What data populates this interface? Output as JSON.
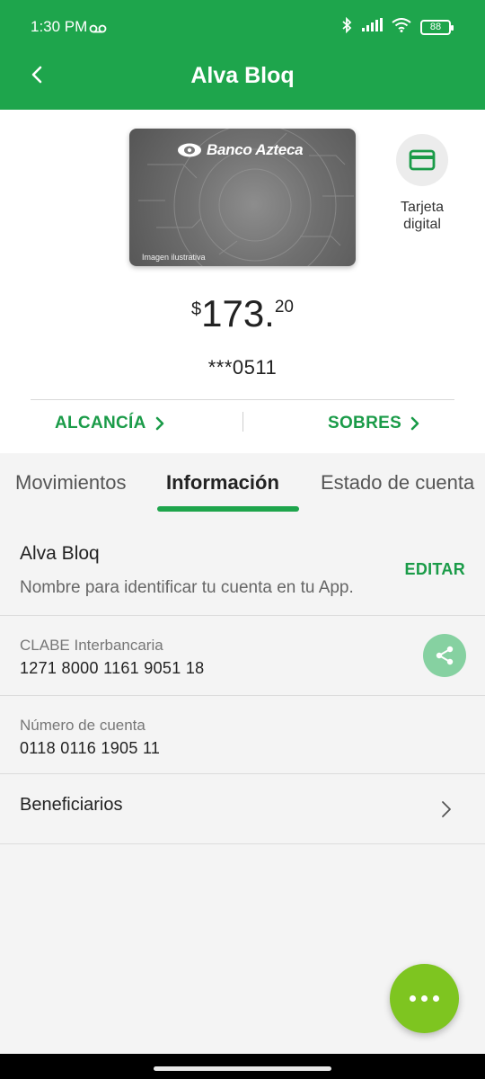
{
  "status_bar": {
    "time": "1:30 PM",
    "battery": "88"
  },
  "app_bar": {
    "title": "Alva Bloq"
  },
  "card": {
    "bank_name": "Banco Azteca",
    "caption": "Imagen ilustrativa",
    "digital_label_line1": "Tarjeta",
    "digital_label_line2": "digital"
  },
  "balance": {
    "currency": "$",
    "integer": "173.",
    "cents": "20"
  },
  "account_mask": "***0511",
  "quick_links": {
    "alcancia": "ALCANCÍA",
    "sobres": "SOBRES"
  },
  "tabs": [
    {
      "label": "Movimientos",
      "active": false
    },
    {
      "label": "Información",
      "active": true
    },
    {
      "label": "Estado de cuenta",
      "active": false
    }
  ],
  "info": {
    "name": {
      "title": "Alva Bloq",
      "description": "Nombre para identificar tu cuenta en tu App.",
      "edit_label": "EDITAR"
    },
    "clabe": {
      "label": "CLABE Interbancaria",
      "value": "1271 8000 1161 9051 18"
    },
    "cuenta": {
      "label": "Número de cuenta",
      "value": "0118 0116 1905 11"
    },
    "beneficiarios": {
      "label": "Beneficiarios"
    }
  },
  "colors": {
    "brand_green": "#1ea54c",
    "link_green": "#1a9b48",
    "fab_green": "#7ec520",
    "share_green": "#86d1a1"
  },
  "icons": [
    "back-arrow-icon",
    "voicemail-icon",
    "bluetooth-icon",
    "signal-icon",
    "wifi-icon",
    "battery-icon",
    "credit-card-icon",
    "chevron-right-icon",
    "share-icon",
    "more-dots-icon"
  ]
}
